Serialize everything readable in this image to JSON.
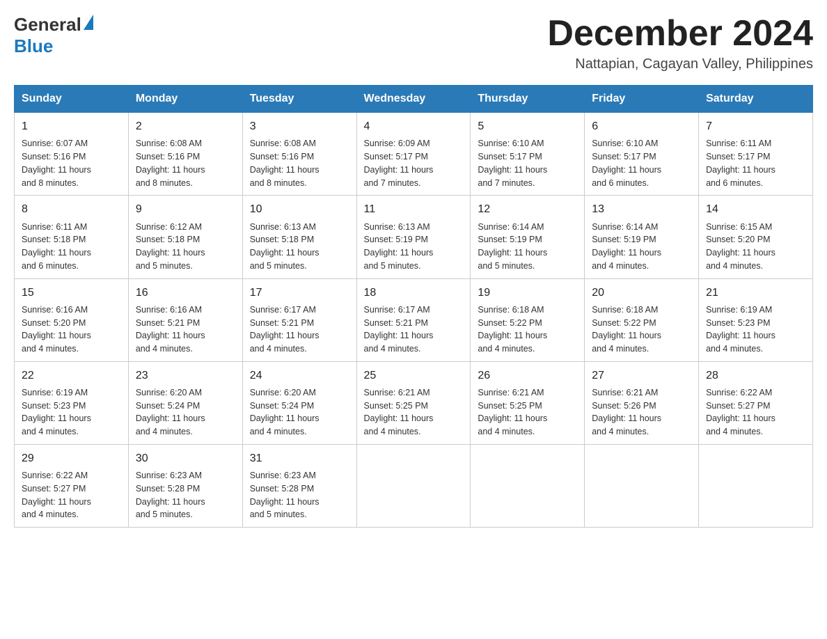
{
  "header": {
    "logo_general": "General",
    "logo_blue": "Blue",
    "month_title": "December 2024",
    "location": "Nattapian, Cagayan Valley, Philippines"
  },
  "days_of_week": [
    "Sunday",
    "Monday",
    "Tuesday",
    "Wednesday",
    "Thursday",
    "Friday",
    "Saturday"
  ],
  "weeks": [
    [
      {
        "date": "1",
        "sunrise": "6:07 AM",
        "sunset": "5:16 PM",
        "daylight": "11 hours and 8 minutes."
      },
      {
        "date": "2",
        "sunrise": "6:08 AM",
        "sunset": "5:16 PM",
        "daylight": "11 hours and 8 minutes."
      },
      {
        "date": "3",
        "sunrise": "6:08 AM",
        "sunset": "5:16 PM",
        "daylight": "11 hours and 8 minutes."
      },
      {
        "date": "4",
        "sunrise": "6:09 AM",
        "sunset": "5:17 PM",
        "daylight": "11 hours and 7 minutes."
      },
      {
        "date": "5",
        "sunrise": "6:10 AM",
        "sunset": "5:17 PM",
        "daylight": "11 hours and 7 minutes."
      },
      {
        "date": "6",
        "sunrise": "6:10 AM",
        "sunset": "5:17 PM",
        "daylight": "11 hours and 6 minutes."
      },
      {
        "date": "7",
        "sunrise": "6:11 AM",
        "sunset": "5:17 PM",
        "daylight": "11 hours and 6 minutes."
      }
    ],
    [
      {
        "date": "8",
        "sunrise": "6:11 AM",
        "sunset": "5:18 PM",
        "daylight": "11 hours and 6 minutes."
      },
      {
        "date": "9",
        "sunrise": "6:12 AM",
        "sunset": "5:18 PM",
        "daylight": "11 hours and 5 minutes."
      },
      {
        "date": "10",
        "sunrise": "6:13 AM",
        "sunset": "5:18 PM",
        "daylight": "11 hours and 5 minutes."
      },
      {
        "date": "11",
        "sunrise": "6:13 AM",
        "sunset": "5:19 PM",
        "daylight": "11 hours and 5 minutes."
      },
      {
        "date": "12",
        "sunrise": "6:14 AM",
        "sunset": "5:19 PM",
        "daylight": "11 hours and 5 minutes."
      },
      {
        "date": "13",
        "sunrise": "6:14 AM",
        "sunset": "5:19 PM",
        "daylight": "11 hours and 4 minutes."
      },
      {
        "date": "14",
        "sunrise": "6:15 AM",
        "sunset": "5:20 PM",
        "daylight": "11 hours and 4 minutes."
      }
    ],
    [
      {
        "date": "15",
        "sunrise": "6:16 AM",
        "sunset": "5:20 PM",
        "daylight": "11 hours and 4 minutes."
      },
      {
        "date": "16",
        "sunrise": "6:16 AM",
        "sunset": "5:21 PM",
        "daylight": "11 hours and 4 minutes."
      },
      {
        "date": "17",
        "sunrise": "6:17 AM",
        "sunset": "5:21 PM",
        "daylight": "11 hours and 4 minutes."
      },
      {
        "date": "18",
        "sunrise": "6:17 AM",
        "sunset": "5:21 PM",
        "daylight": "11 hours and 4 minutes."
      },
      {
        "date": "19",
        "sunrise": "6:18 AM",
        "sunset": "5:22 PM",
        "daylight": "11 hours and 4 minutes."
      },
      {
        "date": "20",
        "sunrise": "6:18 AM",
        "sunset": "5:22 PM",
        "daylight": "11 hours and 4 minutes."
      },
      {
        "date": "21",
        "sunrise": "6:19 AM",
        "sunset": "5:23 PM",
        "daylight": "11 hours and 4 minutes."
      }
    ],
    [
      {
        "date": "22",
        "sunrise": "6:19 AM",
        "sunset": "5:23 PM",
        "daylight": "11 hours and 4 minutes."
      },
      {
        "date": "23",
        "sunrise": "6:20 AM",
        "sunset": "5:24 PM",
        "daylight": "11 hours and 4 minutes."
      },
      {
        "date": "24",
        "sunrise": "6:20 AM",
        "sunset": "5:24 PM",
        "daylight": "11 hours and 4 minutes."
      },
      {
        "date": "25",
        "sunrise": "6:21 AM",
        "sunset": "5:25 PM",
        "daylight": "11 hours and 4 minutes."
      },
      {
        "date": "26",
        "sunrise": "6:21 AM",
        "sunset": "5:25 PM",
        "daylight": "11 hours and 4 minutes."
      },
      {
        "date": "27",
        "sunrise": "6:21 AM",
        "sunset": "5:26 PM",
        "daylight": "11 hours and 4 minutes."
      },
      {
        "date": "28",
        "sunrise": "6:22 AM",
        "sunset": "5:27 PM",
        "daylight": "11 hours and 4 minutes."
      }
    ],
    [
      {
        "date": "29",
        "sunrise": "6:22 AM",
        "sunset": "5:27 PM",
        "daylight": "11 hours and 4 minutes."
      },
      {
        "date": "30",
        "sunrise": "6:23 AM",
        "sunset": "5:28 PM",
        "daylight": "11 hours and 5 minutes."
      },
      {
        "date": "31",
        "sunrise": "6:23 AM",
        "sunset": "5:28 PM",
        "daylight": "11 hours and 5 minutes."
      },
      null,
      null,
      null,
      null
    ]
  ],
  "sunrise_label": "Sunrise:",
  "sunset_label": "Sunset:",
  "daylight_label": "Daylight:"
}
